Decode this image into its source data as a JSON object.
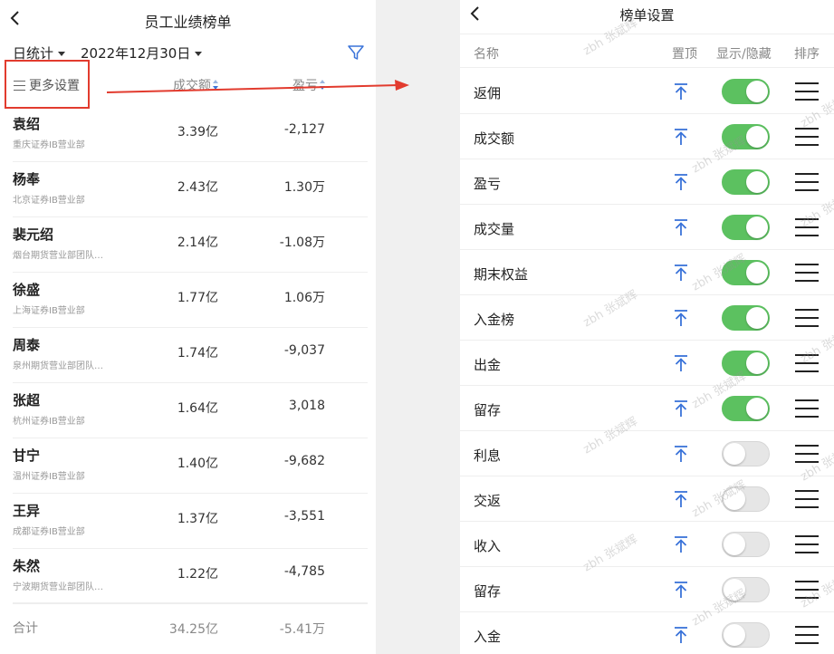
{
  "left": {
    "title": "员工业绩榜单",
    "period": "日统计",
    "date": "2022年12月30日",
    "more_settings": "更多设置",
    "col_amount": "成交额",
    "col_pnl": "盈亏",
    "rows": [
      {
        "name": "袁绍",
        "dept": "重庆证券IB营业部",
        "amount": "3.39亿",
        "pnl": "-2,127"
      },
      {
        "name": "杨奉",
        "dept": "北京证券IB营业部",
        "amount": "2.43亿",
        "pnl": "1.30万"
      },
      {
        "name": "裴元绍",
        "dept": "烟台期货营业部团队…",
        "amount": "2.14亿",
        "pnl": "-1.08万"
      },
      {
        "name": "徐盛",
        "dept": "上海证券IB营业部",
        "amount": "1.77亿",
        "pnl": "1.06万"
      },
      {
        "name": "周泰",
        "dept": "泉州期货营业部团队…",
        "amount": "1.74亿",
        "pnl": "-9,037"
      },
      {
        "name": "张超",
        "dept": "杭州证券IB营业部",
        "amount": "1.64亿",
        "pnl": "3,018"
      },
      {
        "name": "甘宁",
        "dept": "温州证券IB营业部",
        "amount": "1.40亿",
        "pnl": "-9,682"
      },
      {
        "name": "王异",
        "dept": "成都证券IB营业部",
        "amount": "1.37亿",
        "pnl": "-3,551"
      },
      {
        "name": "朱然",
        "dept": "宁波期货营业部团队…",
        "amount": "1.22亿",
        "pnl": "-4,785"
      }
    ],
    "total": {
      "label": "合计",
      "amount": "34.25亿",
      "pnl": "-5.41万"
    }
  },
  "right": {
    "title": "榜单设置",
    "headers": {
      "name": "名称",
      "pin": "置顶",
      "show": "显示/隐藏",
      "sort": "排序"
    },
    "rows": [
      {
        "name": "返佣",
        "on": true
      },
      {
        "name": "成交额",
        "on": true
      },
      {
        "name": "盈亏",
        "on": true
      },
      {
        "name": "成交量",
        "on": true
      },
      {
        "name": "期末权益",
        "on": true
      },
      {
        "name": "入金榜",
        "on": true
      },
      {
        "name": "出金",
        "on": true
      },
      {
        "name": "留存",
        "on": true
      },
      {
        "name": "利息",
        "on": false
      },
      {
        "name": "交返",
        "on": false
      },
      {
        "name": "收入",
        "on": false
      },
      {
        "name": "留存",
        "on": false
      },
      {
        "name": "入金",
        "on": false
      }
    ]
  },
  "watermark": "zbh 张斌辉",
  "colors": {
    "accent_blue": "#3a73d9",
    "toggle_on": "#5cc160",
    "highlight_red": "#e23b2e"
  }
}
